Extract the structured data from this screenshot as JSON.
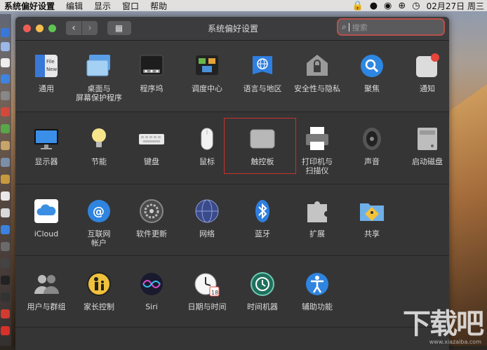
{
  "menubar": {
    "app_name": "系统偏好设置",
    "menus": [
      "编辑",
      "显示",
      "窗口",
      "帮助"
    ],
    "clock": "02月27日 周三"
  },
  "window": {
    "title": "系统偏好设置",
    "nav_back": "‹",
    "nav_forward": "›",
    "grid_button": "▦",
    "search_placeholder": "搜索"
  },
  "rows": [
    {
      "items": [
        {
          "label": "通用",
          "icon": "general-icon"
        },
        {
          "label": "桌面与\n屏幕保护程序",
          "icon": "desktop-screensaver-icon"
        },
        {
          "label": "程序坞",
          "icon": "dock-icon"
        },
        {
          "label": "调度中心",
          "icon": "mission-control-icon"
        },
        {
          "label": "语言与地区",
          "icon": "language-region-icon"
        },
        {
          "label": "安全性与隐私",
          "icon": "security-privacy-icon"
        },
        {
          "label": "聚焦",
          "icon": "spotlight-icon"
        },
        {
          "label": "通知",
          "icon": "notifications-icon"
        }
      ]
    },
    {
      "items": [
        {
          "label": "显示器",
          "icon": "displays-icon"
        },
        {
          "label": "节能",
          "icon": "energy-saver-icon"
        },
        {
          "label": "键盘",
          "icon": "keyboard-icon"
        },
        {
          "label": "鼠标",
          "icon": "mouse-icon"
        },
        {
          "label": "触控板",
          "icon": "trackpad-icon"
        },
        {
          "label": "打印机与\n扫描仪",
          "icon": "printers-scanners-icon"
        },
        {
          "label": "声音",
          "icon": "sound-icon"
        },
        {
          "label": "启动磁盘",
          "icon": "startup-disk-icon"
        }
      ]
    },
    {
      "items": [
        {
          "label": "iCloud",
          "icon": "icloud-icon"
        },
        {
          "label": "互联网\n帐户",
          "icon": "internet-accounts-icon"
        },
        {
          "label": "软件更新",
          "icon": "software-update-icon"
        },
        {
          "label": "网络",
          "icon": "network-icon"
        },
        {
          "label": "蓝牙",
          "icon": "bluetooth-icon"
        },
        {
          "label": "扩展",
          "icon": "extensions-icon"
        },
        {
          "label": "共享",
          "icon": "sharing-icon"
        }
      ]
    },
    {
      "items": [
        {
          "label": "用户与群组",
          "icon": "users-groups-icon"
        },
        {
          "label": "家长控制",
          "icon": "parental-controls-icon"
        },
        {
          "label": "Siri",
          "icon": "siri-icon"
        },
        {
          "label": "日期与时间",
          "icon": "date-time-icon"
        },
        {
          "label": "时间机器",
          "icon": "time-machine-icon"
        },
        {
          "label": "辅助功能",
          "icon": "accessibility-icon"
        }
      ]
    }
  ],
  "highlighted_item": "触控板",
  "watermark": {
    "text": "下载吧",
    "url": "www.xiazaiba.com"
  }
}
